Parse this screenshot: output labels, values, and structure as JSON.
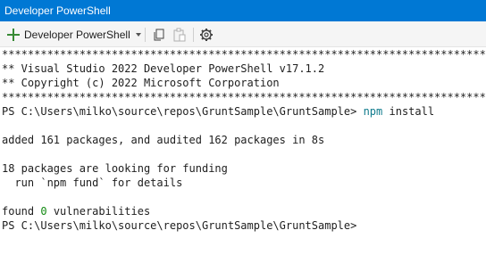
{
  "window": {
    "title": "Developer PowerShell"
  },
  "toolbar": {
    "new_terminal_label": "Developer PowerShell",
    "icons": [
      "plus-icon",
      "chevron-down-icon",
      "copy-icon",
      "paste-icon",
      "settings-icon"
    ]
  },
  "terminal": {
    "stars": "********************************************************************************",
    "banner_line1": "** Visual Studio 2022 Developer PowerShell v17.1.2",
    "banner_line2": "** Copyright (c) 2022 Microsoft Corporation",
    "prompt": "PS C:\\Users\\milko\\source\\repos\\GruntSample\\GruntSample> ",
    "command_name": "npm",
    "command_args": " install",
    "added": "added 161 packages, and audited 162 packages in 8s",
    "funding": "18 packages are looking for funding",
    "funding_hint": "  run `npm fund` for details",
    "found_prefix": "found ",
    "found_count": "0",
    "found_suffix": " vulnerabilities",
    "final_prompt": "PS C:\\Users\\milko\\source\\repos\\GruntSample\\GruntSample>"
  },
  "colors": {
    "titlebar": "#0078d4",
    "command": "#0f7b8c",
    "zero_count": "#128a12",
    "add_icon": "#388a34"
  }
}
